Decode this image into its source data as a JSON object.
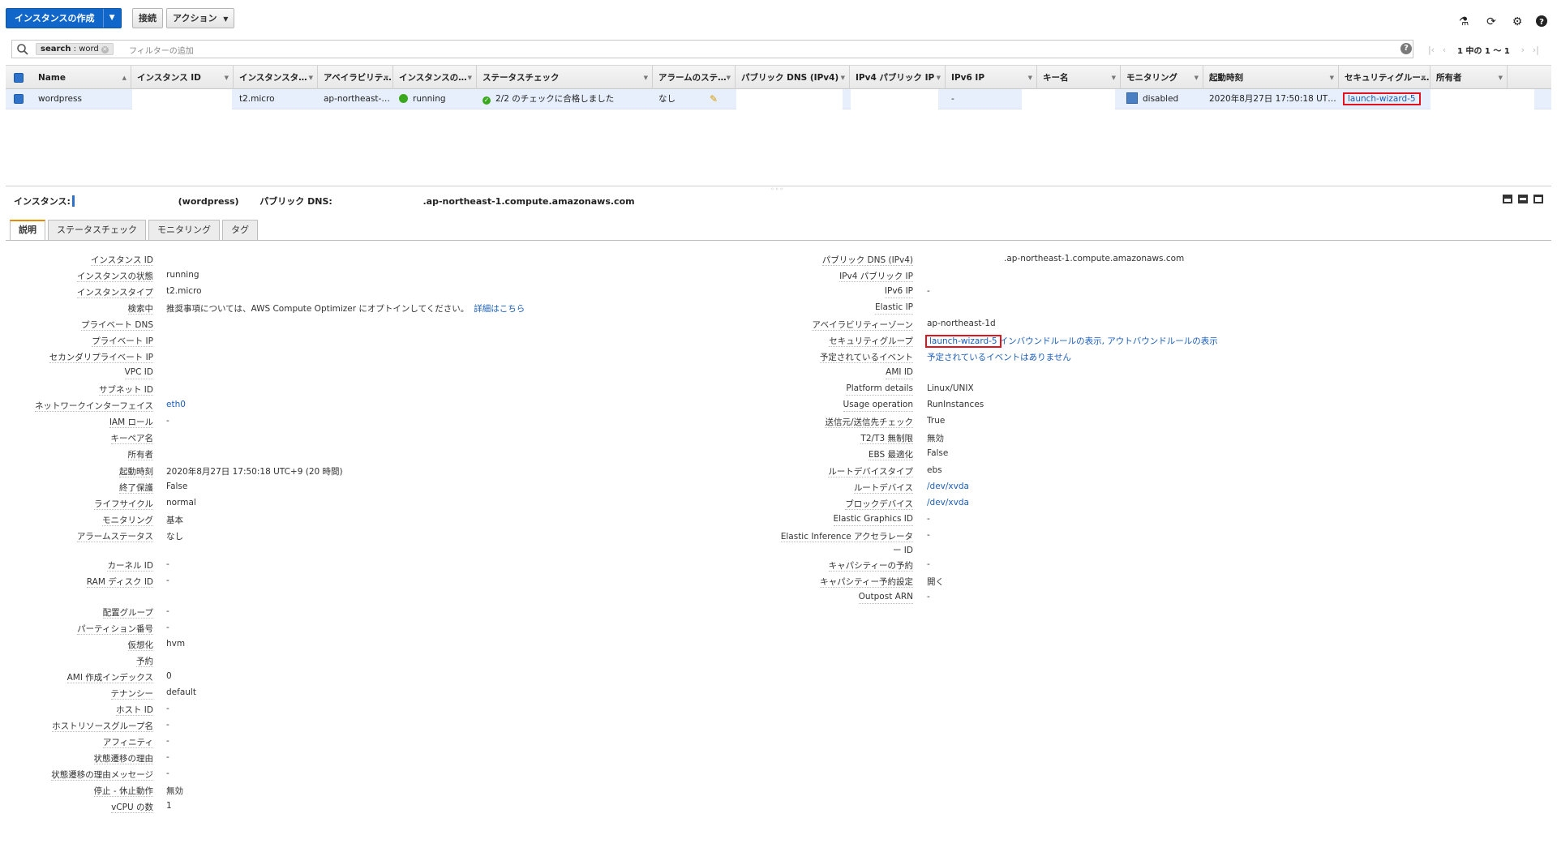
{
  "toolbar": {
    "create_label": "インスタンスの作成",
    "connect_label": "接続",
    "actions_label": "アクション"
  },
  "search": {
    "chip_key": "search",
    "chip_value": ": word",
    "placeholder": "フィルターの追加"
  },
  "pager": {
    "text": "1 中の 1 〜 1"
  },
  "columns": [
    "Name",
    "インスタンス ID",
    "インスタンスタ…",
    "アベイラビリテ…",
    "インスタンスの…",
    "ステータスチェック",
    "アラームのステ…",
    "パブリック DNS (IPv4)",
    "IPv4 パブリック IP",
    "IPv6 IP",
    "キー名",
    "モニタリング",
    "起動時刻",
    "セキュリティグルー…",
    "所有者"
  ],
  "row": {
    "name": "wordpress",
    "instance_id": "",
    "instance_type": "t2.micro",
    "az": "ap-northeast-…",
    "state": "running",
    "status_check": "2/2 のチェックに合格しました",
    "alarm": "なし",
    "public_dns": "",
    "ipv4": "",
    "ipv6": "-",
    "key": "",
    "monitoring": "disabled",
    "launch_time": "2020年8月27日 17:50:18 UT…",
    "security_group": "launch-wizard-5",
    "owner": ""
  },
  "detail_header": {
    "instance_label": "インスタンス:",
    "instance_name": "(wordpress)",
    "dns_label": "パブリック DNS:",
    "dns_value": ".ap-northeast-1.compute.amazonaws.com"
  },
  "tabs": [
    "説明",
    "ステータスチェック",
    "モニタリング",
    "タグ"
  ],
  "left_fields": [
    {
      "label": "インスタンス ID",
      "value": ""
    },
    {
      "label": "インスタンスの状態",
      "value": "running"
    },
    {
      "label": "インスタンスタイプ",
      "value": "t2.micro"
    },
    {
      "label": "検索中",
      "value": "推奨事項については、AWS Compute Optimizer にオプトインしてください。",
      "link": "詳細はこちら"
    },
    {
      "label": "プライベート DNS",
      "value": ""
    },
    {
      "label": "プライベート IP",
      "value": ""
    },
    {
      "label": "セカンダリプライベート IP",
      "value": ""
    },
    {
      "label": "VPC ID",
      "value": ""
    },
    {
      "label": "サブネット ID",
      "value": ""
    },
    {
      "label": "ネットワークインターフェイス",
      "link": "eth0"
    },
    {
      "label": "IAM ロール",
      "value": "-"
    },
    {
      "label": "キーペア名",
      "value": ""
    },
    {
      "label": "所有者",
      "value": ""
    },
    {
      "label": "起動時刻",
      "value": "2020年8月27日 17:50:18 UTC+9 (20 時間)"
    },
    {
      "label": "終了保護",
      "value": "False"
    },
    {
      "label": "ライフサイクル",
      "value": "normal"
    },
    {
      "label": "モニタリング",
      "value": "基本"
    },
    {
      "label": "アラームステータス",
      "value": "なし"
    },
    {
      "label": "カーネル ID",
      "value": "-"
    },
    {
      "label": "RAM ディスク ID",
      "value": "-"
    },
    {
      "label": "配置グループ",
      "value": "-"
    },
    {
      "label": "パーティション番号",
      "value": "-"
    },
    {
      "label": "仮想化",
      "value": "hvm"
    },
    {
      "label": "予約",
      "value": ""
    },
    {
      "label": "AMI 作成インデックス",
      "value": "0"
    },
    {
      "label": "テナンシー",
      "value": "default"
    },
    {
      "label": "ホスト ID",
      "value": "-"
    },
    {
      "label": "ホストリソースグループ名",
      "value": "-"
    },
    {
      "label": "アフィニティ",
      "value": "-"
    },
    {
      "label": "状態遷移の理由",
      "value": "-"
    },
    {
      "label": "状態遷移の理由メッセージ",
      "value": "-"
    },
    {
      "label": "停止 - 休止動作",
      "value": "無効"
    },
    {
      "label": "vCPU の数",
      "value": "1"
    }
  ],
  "right_fields": [
    {
      "label": "パブリック DNS (IPv4)",
      "value": ".ap-northeast-1.compute.amazonaws.com"
    },
    {
      "label": "IPv4 パブリック IP",
      "value": ""
    },
    {
      "label": "IPv6 IP",
      "value": "-"
    },
    {
      "label": "Elastic IP",
      "value": ""
    },
    {
      "label": "アベイラビリティーゾーン",
      "value": "ap-northeast-1d"
    },
    {
      "label": "セキュリティグループ",
      "link": "launch-wizard-5",
      "link2": "インバウンドルールの表示",
      "link3": "アウトバウンドルールの表示"
    },
    {
      "label": "予定されているイベント",
      "link": "予定されているイベントはありません"
    },
    {
      "label": "AMI ID",
      "value": ""
    },
    {
      "label": "Platform details",
      "value": "Linux/UNIX"
    },
    {
      "label": "Usage operation",
      "value": "RunInstances"
    },
    {
      "label": "送信元/送信先チェック",
      "value": "True"
    },
    {
      "label": "T2/T3 無制限",
      "value": "無効"
    },
    {
      "label": "EBS 最適化",
      "value": "False"
    },
    {
      "label": "ルートデバイスタイプ",
      "value": "ebs"
    },
    {
      "label": "ルートデバイス",
      "link": "/dev/xvda"
    },
    {
      "label": "ブロックデバイス",
      "link": "/dev/xvda"
    },
    {
      "label": "Elastic Graphics ID",
      "value": "-"
    },
    {
      "label": "Elastic Inference アクセラレータ",
      "label2": "ー ID",
      "value": "-"
    },
    {
      "label": "キャパシティーの予約",
      "value": "-"
    },
    {
      "label": "キャパシティー予約設定",
      "value": "開く"
    },
    {
      "label": "Outpost ARN",
      "value": "-"
    }
  ]
}
